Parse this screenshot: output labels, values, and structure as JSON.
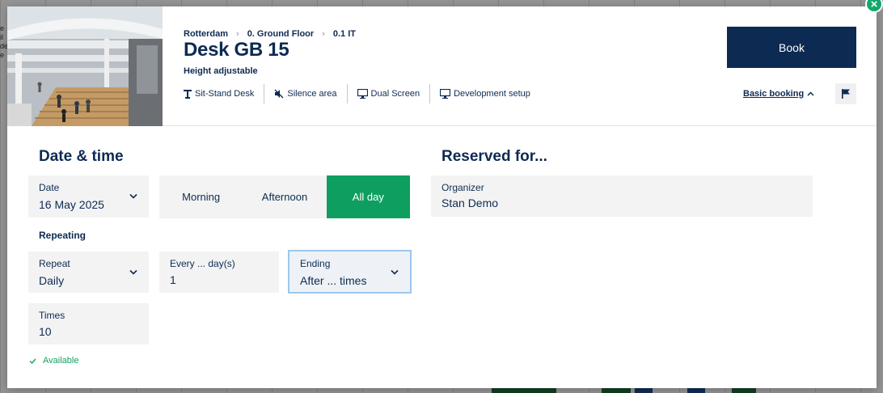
{
  "header": {
    "breadcrumb": [
      "Rotterdam",
      "0. Ground Floor",
      "0.1 IT"
    ],
    "title": "Desk GB 15",
    "subtitle": "Height adjustable",
    "features": [
      {
        "label": "Sit-Stand Desk",
        "icon": "desk-icon"
      },
      {
        "label": "Silence area",
        "icon": "mute-icon"
      },
      {
        "label": "Dual Screen",
        "icon": "monitor-icon"
      },
      {
        "label": "Development setup",
        "icon": "monitor-icon"
      }
    ],
    "book_label": "Book",
    "basic_booking_label": "Basic booking"
  },
  "date_time": {
    "heading": "Date & time",
    "date_label": "Date",
    "date_value": "16 May 2025",
    "segments": [
      "Morning",
      "Afternoon",
      "All day"
    ],
    "selected_segment": "All day"
  },
  "repeating": {
    "heading": "Repeating",
    "repeat_label": "Repeat",
    "repeat_value": "Daily",
    "every_label": "Every ... day(s)",
    "every_value": "1",
    "ending_label": "Ending",
    "ending_value": "After ... times",
    "times_label": "Times",
    "times_value": "10"
  },
  "status": {
    "available_text": "Available"
  },
  "reserved": {
    "heading": "Reserved for...",
    "organizer_label": "Organizer",
    "organizer_value": "Stan Demo"
  },
  "colors": {
    "primary": "#0d2b52",
    "accent": "#0e9f60",
    "field_bg": "#f3f3f3",
    "focus": "#9cc7ee"
  }
}
